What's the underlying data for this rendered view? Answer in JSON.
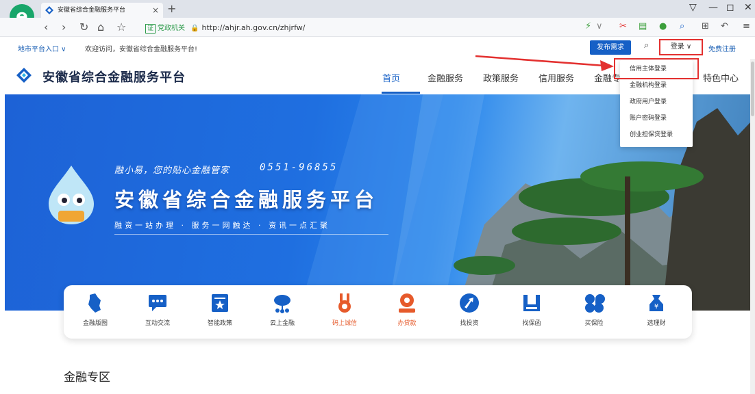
{
  "browser": {
    "tab_title": "安徽省综合金融服务平台",
    "tab_close": "×",
    "new_tab": "+",
    "logo_letter": "e",
    "gov_badge": "证",
    "gov_text": "党政机关",
    "url": "http://ahjr.ah.gov.cn/zhjrfw/"
  },
  "topbar": {
    "city_entry": "地市平台入口 ∨",
    "welcome": "欢迎访问，安徽省综合金融服务平台!",
    "publish_button": "发布需求",
    "login_button": "登录 ∨",
    "register_link": "免费注册"
  },
  "header": {
    "site_name": "安徽省综合金融服务平台",
    "nav": [
      "首页",
      "金融服务",
      "政策服务",
      "信用服务",
      "金融专",
      "特色中心"
    ]
  },
  "banner": {
    "slogan": "融小易，您的贴心金融管家",
    "hotline": "0551-96855",
    "title": "安徽省综合金融服务平台",
    "subtitle": "融资一站办理 · 服务一网触达 · 资讯一点汇聚"
  },
  "services": [
    {
      "label": "金融版图",
      "icon": "map-icon",
      "color": "#1660c6"
    },
    {
      "label": "互动交流",
      "icon": "chat-icon",
      "color": "#1660c6"
    },
    {
      "label": "智能政策",
      "icon": "policy-icon",
      "color": "#1660c6"
    },
    {
      "label": "云上金融",
      "icon": "cloud-icon",
      "color": "#1660c6"
    },
    {
      "label": "码上诚信",
      "icon": "medal-icon",
      "color": "#e65a2b",
      "hot": true
    },
    {
      "label": "办贷款",
      "icon": "loan-icon",
      "color": "#e65a2b",
      "hot": true
    },
    {
      "label": "找投资",
      "icon": "invest-icon",
      "color": "#1660c6"
    },
    {
      "label": "找保函",
      "icon": "guarantee-icon",
      "color": "#1660c6"
    },
    {
      "label": "买保险",
      "icon": "insurance-icon",
      "color": "#1660c6"
    },
    {
      "label": "选理财",
      "icon": "wealth-icon",
      "color": "#1660c6"
    }
  ],
  "section_title": "金融专区",
  "login_menu": [
    "信用主体登录",
    "金融机构登录",
    "政府用户登录",
    "账户密码登录",
    "创业担保贷登录"
  ],
  "colors": {
    "brand": "#1660c6",
    "highlight": "#e3302f",
    "hot": "#e65a2b"
  }
}
